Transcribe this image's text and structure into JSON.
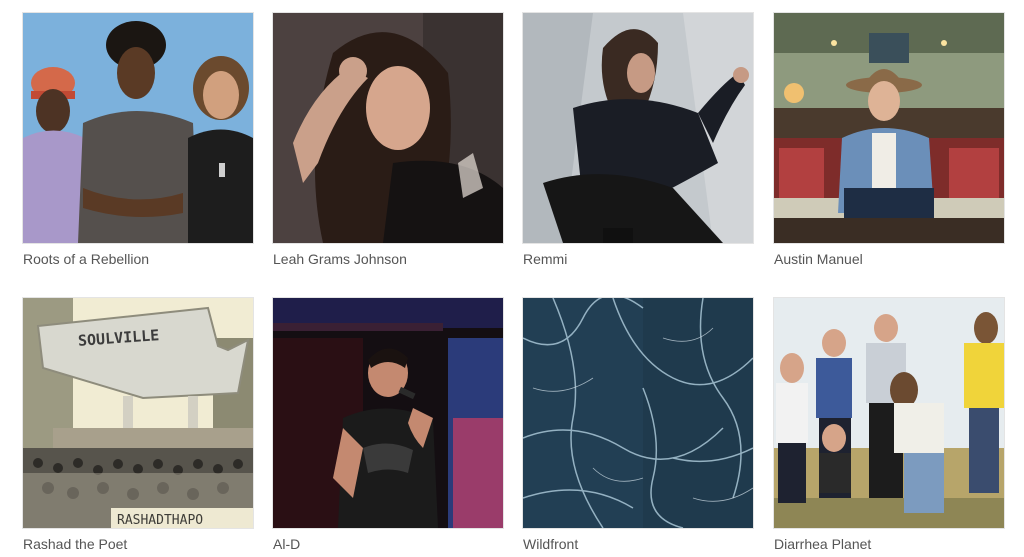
{
  "artists": [
    {
      "name": "Roots of a Rebellion"
    },
    {
      "name": "Leah Grams Johnson"
    },
    {
      "name": "Remmi"
    },
    {
      "name": "Austin Manuel"
    },
    {
      "name": "Rashad the Poet",
      "image_text": {
        "sign": "SOULVILLE",
        "stamp": "RASHADTHAPO"
      }
    },
    {
      "name": "Al-D"
    },
    {
      "name": "Wildfront"
    },
    {
      "name": "Diarrhea Planet"
    }
  ]
}
